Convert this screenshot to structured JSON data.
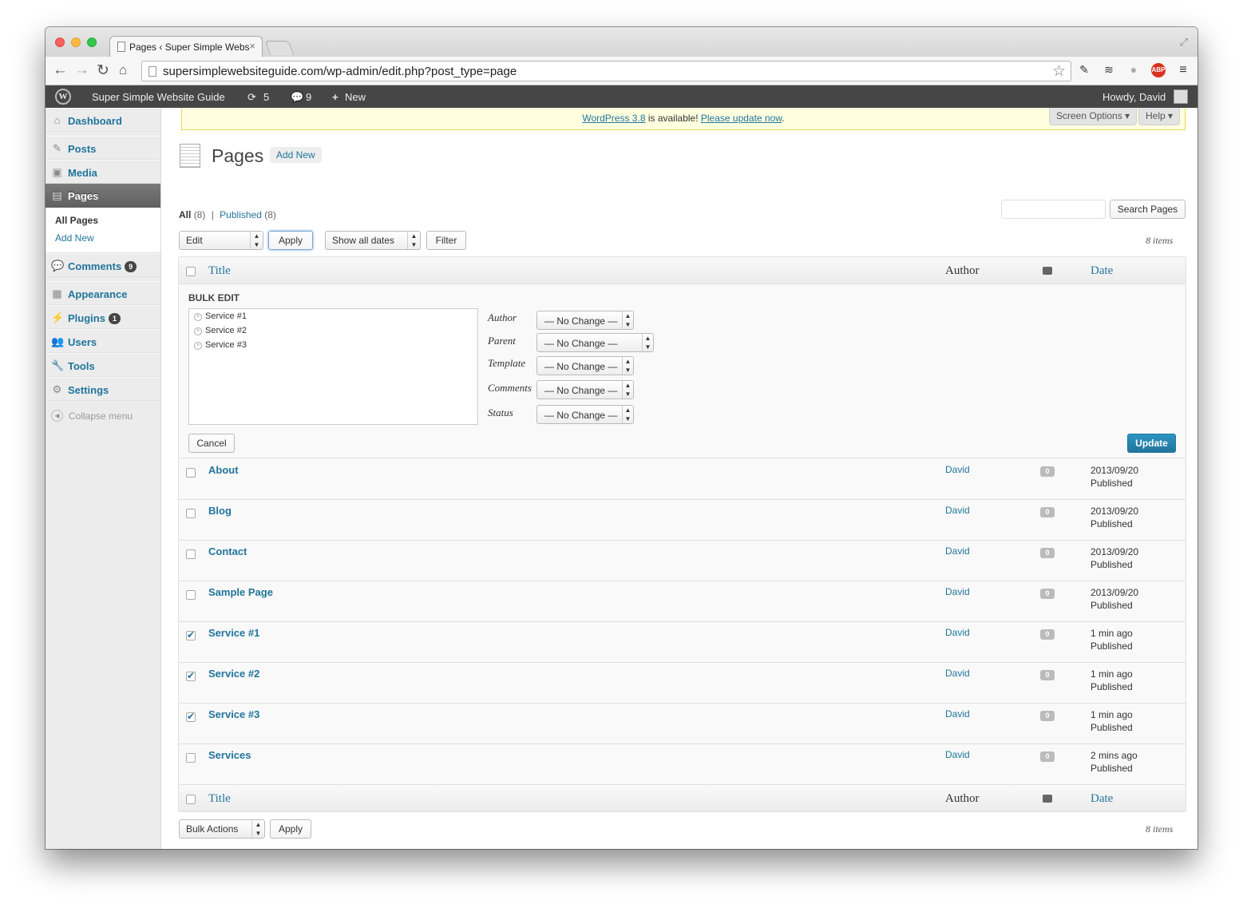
{
  "browser": {
    "tab_title": "Pages ‹ Super Simple Webs",
    "tab_close": "×",
    "url": "supersimplewebsiteguide.com/wp-admin/edit.php?post_type=page",
    "abp": "ABP"
  },
  "adminbar": {
    "site_name": "Super Simple Website Guide",
    "updates_count": "5",
    "comments_count": "9",
    "new_label": "New",
    "howdy": "Howdy, David"
  },
  "sidebar": {
    "dashboard": "Dashboard",
    "posts": "Posts",
    "media": "Media",
    "pages": "Pages",
    "sub_all_pages": "All Pages",
    "sub_add_new": "Add New",
    "comments": "Comments",
    "comments_badge": "9",
    "appearance": "Appearance",
    "plugins": "Plugins",
    "plugins_badge": "1",
    "users": "Users",
    "tools": "Tools",
    "settings": "Settings",
    "collapse": "Collapse menu"
  },
  "notice": {
    "link1": "WordPress 3.8",
    "text": " is available! ",
    "link2": "Please update now",
    "end": "."
  },
  "screen_options": "Screen Options ▾",
  "help": "Help ▾",
  "page": {
    "title": "Pages",
    "add_new": "Add New",
    "filter_all": "All",
    "filter_all_count": "(8)",
    "filter_sep": "|",
    "filter_published": "Published",
    "filter_published_count": "(8)",
    "search_button": "Search Pages",
    "search_value": "",
    "bulk_action_top": "Edit",
    "apply": "Apply",
    "dates": "Show all dates",
    "filter_btn": "Filter",
    "items": "8 items",
    "bulk_action_bottom": "Bulk Actions"
  },
  "table": {
    "col_title": "Title",
    "col_author": "Author",
    "col_date": "Date"
  },
  "bulk_edit": {
    "title": "BULK EDIT",
    "items": [
      "Service #1",
      "Service #2",
      "Service #3"
    ],
    "labels": {
      "author": "Author",
      "parent": "Parent",
      "template": "Template",
      "comments": "Comments",
      "status": "Status"
    },
    "no_change": "— No Change —",
    "cancel": "Cancel",
    "update": "Update"
  },
  "rows": [
    {
      "title": "About",
      "author": "David",
      "comments": "0",
      "date": "2013/09/20",
      "status": "Published",
      "checked": false
    },
    {
      "title": "Blog",
      "author": "David",
      "comments": "0",
      "date": "2013/09/20",
      "status": "Published",
      "checked": false
    },
    {
      "title": "Contact",
      "author": "David",
      "comments": "0",
      "date": "2013/09/20",
      "status": "Published",
      "checked": false
    },
    {
      "title": "Sample Page",
      "author": "David",
      "comments": "0",
      "date": "2013/09/20",
      "status": "Published",
      "checked": false
    },
    {
      "title": "Service #1",
      "author": "David",
      "comments": "0",
      "date": "1 min ago",
      "status": "Published",
      "checked": true
    },
    {
      "title": "Service #2",
      "author": "David",
      "comments": "0",
      "date": "1 min ago",
      "status": "Published",
      "checked": true
    },
    {
      "title": "Service #3",
      "author": "David",
      "comments": "0",
      "date": "1 min ago",
      "status": "Published",
      "checked": true
    },
    {
      "title": "Services",
      "author": "David",
      "comments": "0",
      "date": "2 mins ago",
      "status": "Published",
      "checked": false
    }
  ]
}
